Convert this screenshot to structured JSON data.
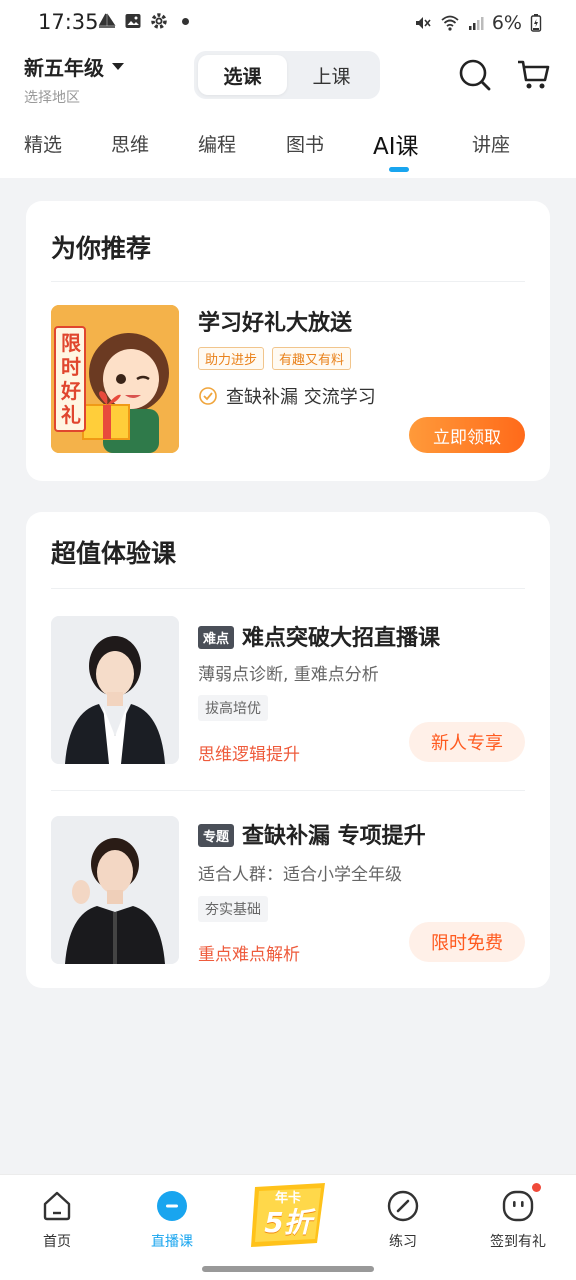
{
  "status": {
    "time": "17:35",
    "battery": "6%"
  },
  "header": {
    "grade": "新五年级",
    "region": "选择地区",
    "seg_select": "选课",
    "seg_attend": "上课"
  },
  "tabs": [
    "精选",
    "思维",
    "编程",
    "图书",
    "AI课",
    "讲座"
  ],
  "recommend": {
    "title": "为你推荐",
    "item_title": "学习好礼大放送",
    "tags": [
      "助力进步",
      "有趣又有料"
    ],
    "check_text": "查缺补漏 交流学习",
    "button": "立即领取",
    "thumb_text": "限时好礼"
  },
  "trial": {
    "title": "超值体验课",
    "courses": [
      {
        "badge": "难点",
        "title": "难点突破大招直播课",
        "desc": "薄弱点诊断, 重难点分析",
        "tag": "拔高培优",
        "highlight": "思维逻辑提升",
        "button": "新人专享"
      },
      {
        "badge": "专题",
        "title": "查缺补漏 专项提升",
        "desc": "适合人群：适合小学全年级",
        "tag": "夯实基础",
        "highlight": "重点难点解析",
        "button": "限时免费"
      }
    ]
  },
  "bottom_nav": {
    "home": "首页",
    "live": "直播课",
    "promo_top": "年卡",
    "promo_main": "5折",
    "practice": "练习",
    "checkin": "签到有礼"
  },
  "colors": {
    "accent": "#19a5ef",
    "orange": "#ff7a25",
    "red": "#ee5b3c"
  }
}
